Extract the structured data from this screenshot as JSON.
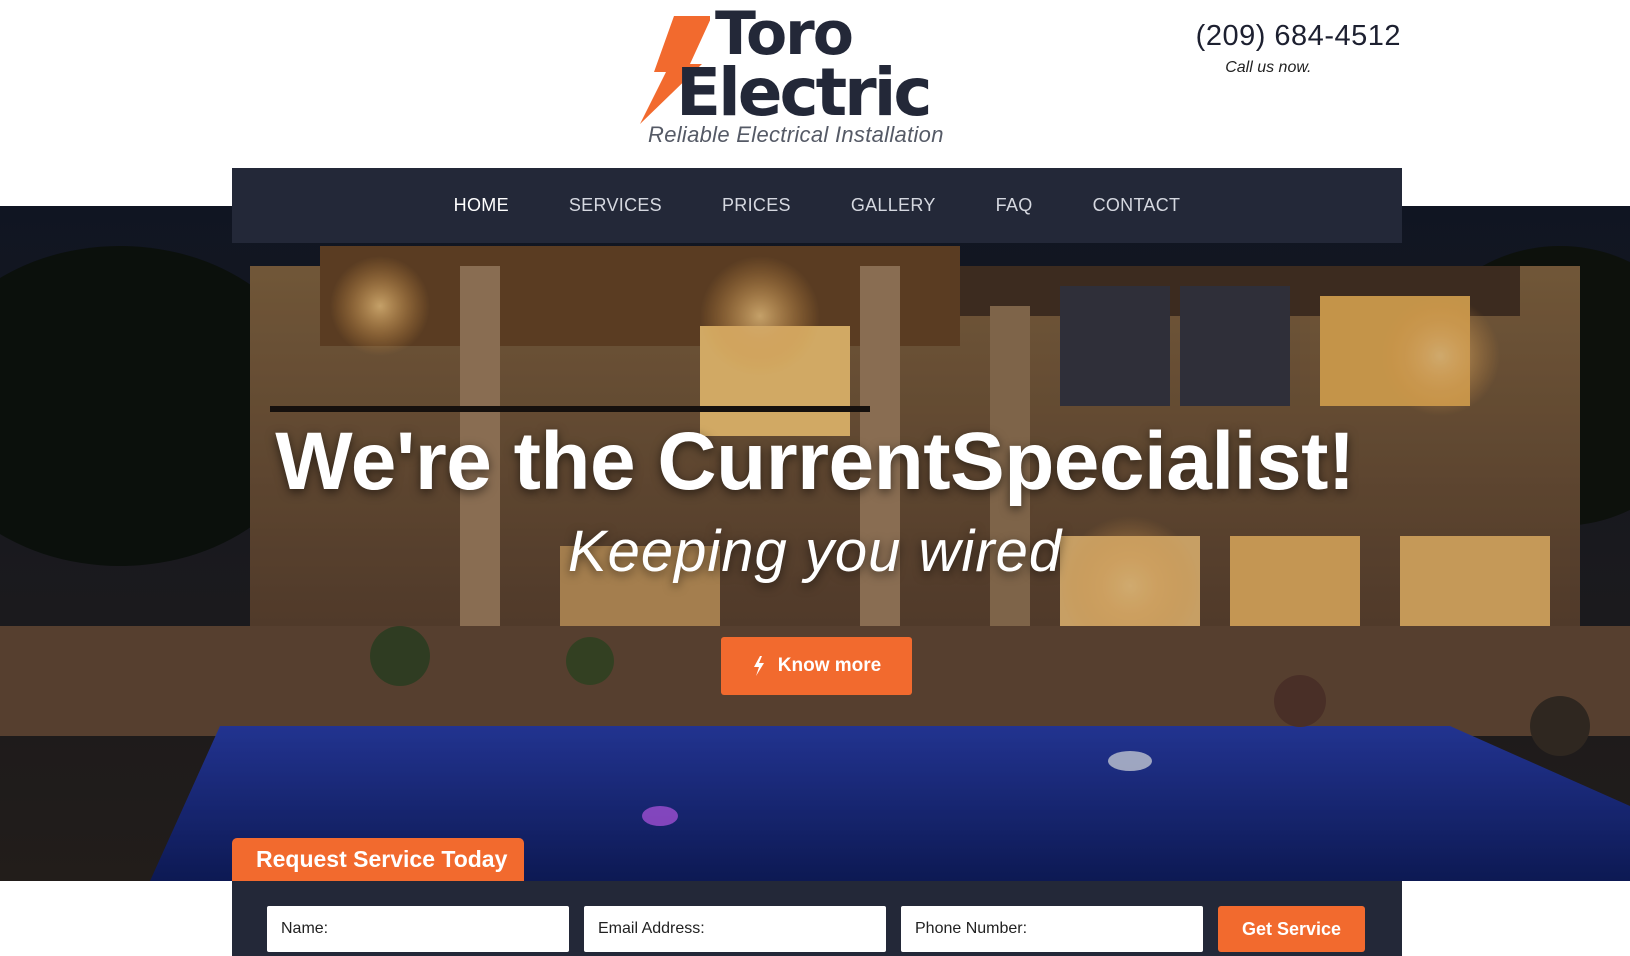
{
  "brand": {
    "name_line1": "Toro",
    "name_line2": "Electric",
    "tagline": "Reliable Electrical Installation",
    "accent_color": "#f26a2e",
    "dark_color": "#232838"
  },
  "contact": {
    "phone": "(209) 684-4512",
    "note": "Call us now."
  },
  "nav": {
    "items": [
      {
        "label": "HOME",
        "active": true
      },
      {
        "label": "SERVICES"
      },
      {
        "label": "PRICES"
      },
      {
        "label": "GALLERY"
      },
      {
        "label": "FAQ"
      },
      {
        "label": "CONTACT"
      }
    ]
  },
  "hero": {
    "title": "We're the CurrentSpecialist!",
    "subtitle": "Keeping you wired",
    "cta_label": "Know more",
    "cta_icon": "bolt-icon",
    "background": "night-house-pool-photo"
  },
  "request": {
    "tab_label": "Request Service Today",
    "name_placeholder": "Name:",
    "email_placeholder": "Email Address:",
    "phone_placeholder": "Phone Number:",
    "submit_label": "Get Service"
  }
}
